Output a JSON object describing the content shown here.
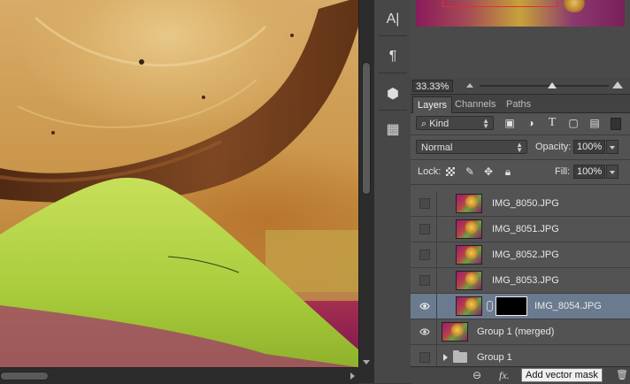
{
  "tool_strip": {
    "tools": [
      {
        "name": "character-panel-icon",
        "glyph": "A|"
      },
      {
        "name": "paragraph-panel-icon",
        "glyph": "¶"
      },
      {
        "name": "3d-panel-icon",
        "glyph": "⬢"
      },
      {
        "name": "properties-panel-icon",
        "glyph": "▦"
      }
    ]
  },
  "navigator": {
    "zoom": "33.33%",
    "zoom_slider_fraction": 0.56
  },
  "layers_panel": {
    "tabs": [
      {
        "label": "Layers",
        "active": true
      },
      {
        "label": "Channels",
        "active": false
      },
      {
        "label": "Paths",
        "active": false
      }
    ],
    "filter": {
      "kind_label": "Kind",
      "filter_icons": [
        "pixel-filter-icon",
        "adjustment-filter-icon",
        "type-filter-icon",
        "shape-filter-icon",
        "smart-object-filter-icon"
      ]
    },
    "blend_mode": "Normal",
    "opacity_label": "Opacity:",
    "opacity_value": "100%",
    "lock_label": "Lock:",
    "fill_label": "Fill:",
    "fill_value": "100%",
    "layers": [
      {
        "name": "IMG_8050.JPG",
        "visible": false,
        "selected": false
      },
      {
        "name": "IMG_8051.JPG",
        "visible": false,
        "selected": false
      },
      {
        "name": "IMG_8052.JPG",
        "visible": false,
        "selected": false
      },
      {
        "name": "IMG_8053.JPG",
        "visible": false,
        "selected": false
      },
      {
        "name": "IMG_8054.JPG",
        "visible": true,
        "selected": true,
        "has_mask": true
      },
      {
        "name": "Group 1 (merged)",
        "visible": true,
        "selected": false
      },
      {
        "name": "Group 1",
        "visible": false,
        "selected": false,
        "is_group": true
      }
    ]
  },
  "bottom_bar": {
    "link_glyph": "⊖",
    "fx_label": "fx.",
    "tooltip": "Add vector mask",
    "trash_glyph": "🗑"
  }
}
